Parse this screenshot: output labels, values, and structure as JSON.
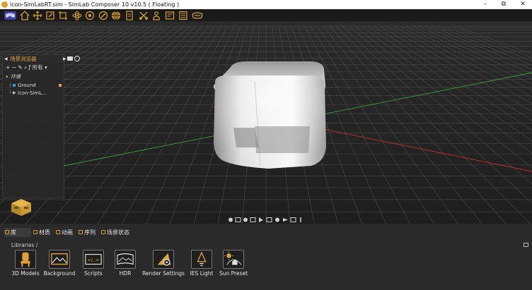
{
  "window": {
    "title": "icon-SimLabRT.sim - SimLab Composer 10 v10.5 ( Floating )",
    "minimize_glyph": "–",
    "maximize_glyph": "⧉",
    "close_glyph": "✕"
  },
  "toolbar": {
    "icons": [
      "vr-glasses-icon",
      "house-icon",
      "move-icon",
      "edit-icon",
      "crop-icon",
      "atom-icon",
      "eye-icon",
      "compass-icon",
      "sphere-icon",
      "document-icon",
      "scissors-icon",
      "person-icon",
      "panel-icon",
      "film-icon",
      "visor-icon"
    ],
    "accent": "#d9a02a"
  },
  "scene_browser": {
    "title": "场景浏览器",
    "tools": "+ − ✎ ⌕ ƒ  所有 ▾",
    "root": "环境",
    "items": [
      {
        "label": "Ground",
        "lock": true
      },
      {
        "label": "icon-SimL..."
      }
    ]
  },
  "bottom": {
    "tabs": [
      {
        "label": "库",
        "active": true
      },
      {
        "label": "材质"
      },
      {
        "label": "动画"
      },
      {
        "label": "序列"
      },
      {
        "label": "场景状态"
      }
    ],
    "breadcrumb": "Libraries /",
    "libraries": [
      {
        "label": "3D Models",
        "icon": "chair-icon"
      },
      {
        "label": "Background",
        "icon": "landscape-icon"
      },
      {
        "label": "Scripts",
        "icon": "code-icon"
      },
      {
        "label": "HDR",
        "icon": "panorama-icon"
      },
      {
        "label": "Render Settings",
        "icon": "render-gear-icon"
      },
      {
        "label": "IES Light",
        "icon": "light-bulb-icon"
      },
      {
        "label": "Sun Preset",
        "icon": "sun-house-icon"
      }
    ]
  }
}
